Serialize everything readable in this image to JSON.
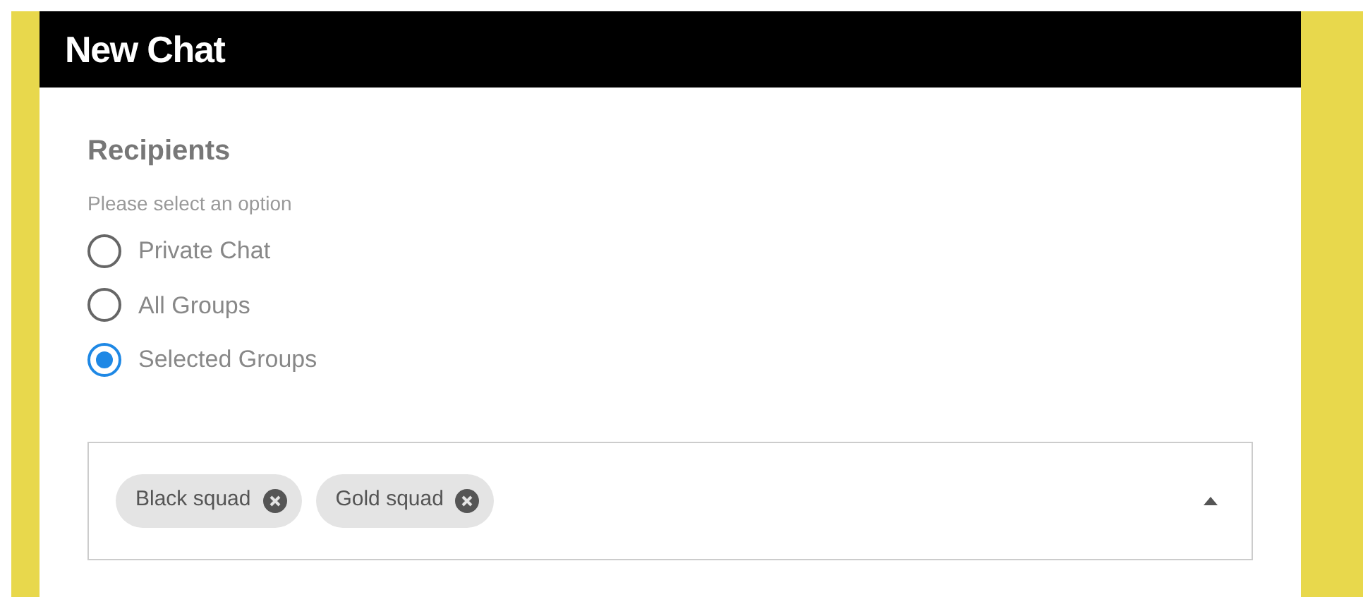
{
  "dialog": {
    "title": "New Chat"
  },
  "recipients": {
    "heading": "Recipients",
    "hint": "Please select an option",
    "options": [
      {
        "label": "Private Chat",
        "selected": false
      },
      {
        "label": "All Groups",
        "selected": false
      },
      {
        "label": "Selected Groups",
        "selected": true
      }
    ]
  },
  "groups_select": {
    "expanded": true,
    "chips": [
      {
        "label": "Black squad"
      },
      {
        "label": "Gold squad"
      }
    ]
  }
}
